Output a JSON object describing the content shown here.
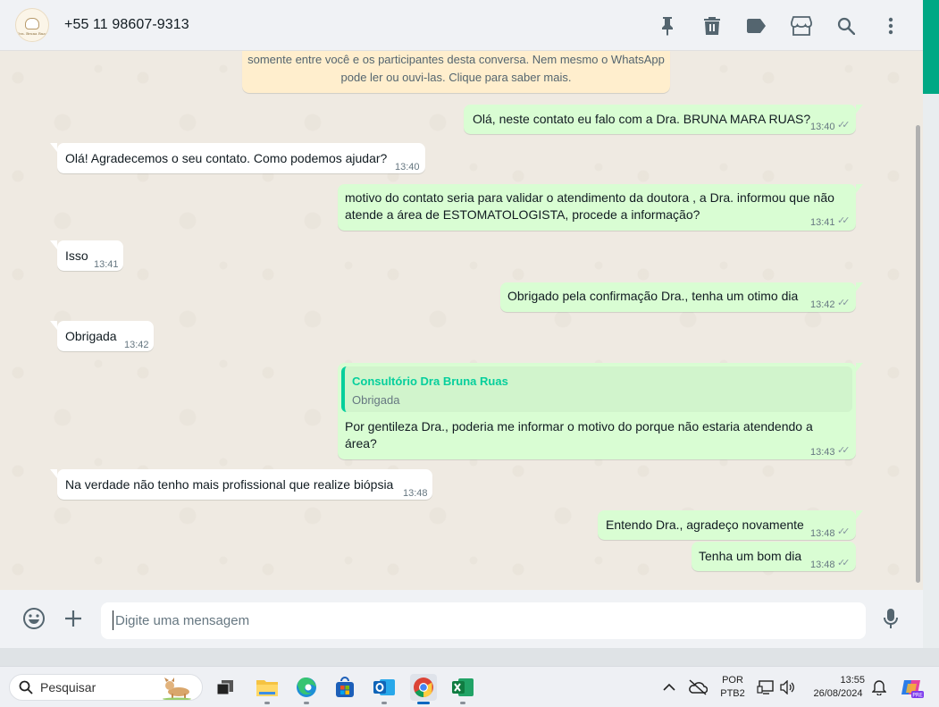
{
  "header": {
    "contact_name": "+55 11 98607-9313",
    "avatar_logo_text": "Dra. Bruna Ruas",
    "icons": [
      "pin-icon",
      "delete-icon",
      "label-icon",
      "store-icon",
      "search-icon",
      "menu-icon"
    ]
  },
  "notice": {
    "line1": "somente entre você e os participantes desta conversa. Nem mesmo o WhatsApp",
    "line2": "pode ler ou ouvi-las. Clique para saber mais."
  },
  "messages": [
    {
      "direction": "out",
      "text": "Olá, neste contato eu falo com a Dra. BRUNA MARA RUAS?",
      "time": "13:40"
    },
    {
      "direction": "in",
      "text": "Olá! Agradecemos o seu contato. Como podemos ajudar?",
      "time": "13:40"
    },
    {
      "direction": "out",
      "line1": "motivo do contato seria para validar o atendimento da doutora , a Dra. informou que não",
      "line2": "atende a área de  ESTOMATOLOGISTA, procede a informação?",
      "time": "13:41"
    },
    {
      "direction": "in",
      "text": "Isso",
      "time": "13:41"
    },
    {
      "direction": "out",
      "text": "Obrigado pela confirmação Dra., tenha um otimo dia",
      "time": "13:42"
    },
    {
      "direction": "in",
      "text": "Obrigada",
      "time": "13:42"
    },
    {
      "direction": "out",
      "quote_author": "Consultório Dra Bruna Ruas",
      "quote_text": "Obrigada",
      "line1": "Por gentileza Dra., poderia me informar o motivo do porque não estaria atendendo a",
      "line2": "área?",
      "time": "13:43"
    },
    {
      "direction": "in",
      "text": "Na verdade não tenho mais profissional que realize biópsia",
      "time": "13:48"
    },
    {
      "direction": "out",
      "text": "Entendo Dra., agradeço novamente",
      "time": "13:48"
    },
    {
      "direction": "out",
      "text": "Tenha um bom dia",
      "time": "13:48"
    }
  ],
  "composer": {
    "placeholder": "Digite uma mensagem",
    "icons": [
      "emoji-icon",
      "plus-icon",
      "microphone-icon"
    ]
  },
  "taskbar": {
    "search_label": "Pesquisar",
    "apps": [
      "task-view",
      "file-explorer",
      "edge",
      "microsoft-store",
      "outlook",
      "chrome",
      "excel"
    ],
    "language_line1": "POR",
    "language_line2": "PTB2",
    "time": "13:55",
    "date": "26/08/2024"
  },
  "colors": {
    "accent": "#00a884",
    "outgoing_bubble": "#d9fdd3",
    "incoming_bubble": "#ffffff",
    "chat_background": "#efeae2",
    "notice_background": "#ffeecd",
    "quote_author": "#06cf9c"
  }
}
